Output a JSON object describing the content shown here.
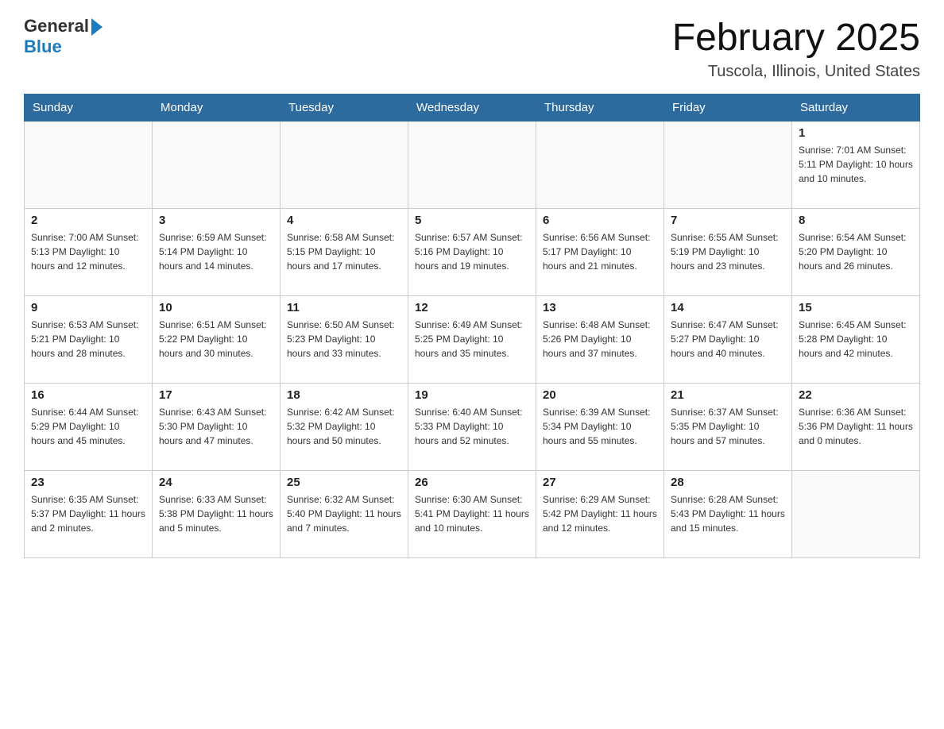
{
  "logo": {
    "text_general": "General",
    "text_blue": "Blue"
  },
  "header": {
    "month_year": "February 2025",
    "location": "Tuscola, Illinois, United States"
  },
  "days_of_week": [
    "Sunday",
    "Monday",
    "Tuesday",
    "Wednesday",
    "Thursday",
    "Friday",
    "Saturday"
  ],
  "weeks": [
    [
      {
        "day": "",
        "info": ""
      },
      {
        "day": "",
        "info": ""
      },
      {
        "day": "",
        "info": ""
      },
      {
        "day": "",
        "info": ""
      },
      {
        "day": "",
        "info": ""
      },
      {
        "day": "",
        "info": ""
      },
      {
        "day": "1",
        "info": "Sunrise: 7:01 AM\nSunset: 5:11 PM\nDaylight: 10 hours and 10 minutes."
      }
    ],
    [
      {
        "day": "2",
        "info": "Sunrise: 7:00 AM\nSunset: 5:13 PM\nDaylight: 10 hours and 12 minutes."
      },
      {
        "day": "3",
        "info": "Sunrise: 6:59 AM\nSunset: 5:14 PM\nDaylight: 10 hours and 14 minutes."
      },
      {
        "day": "4",
        "info": "Sunrise: 6:58 AM\nSunset: 5:15 PM\nDaylight: 10 hours and 17 minutes."
      },
      {
        "day": "5",
        "info": "Sunrise: 6:57 AM\nSunset: 5:16 PM\nDaylight: 10 hours and 19 minutes."
      },
      {
        "day": "6",
        "info": "Sunrise: 6:56 AM\nSunset: 5:17 PM\nDaylight: 10 hours and 21 minutes."
      },
      {
        "day": "7",
        "info": "Sunrise: 6:55 AM\nSunset: 5:19 PM\nDaylight: 10 hours and 23 minutes."
      },
      {
        "day": "8",
        "info": "Sunrise: 6:54 AM\nSunset: 5:20 PM\nDaylight: 10 hours and 26 minutes."
      }
    ],
    [
      {
        "day": "9",
        "info": "Sunrise: 6:53 AM\nSunset: 5:21 PM\nDaylight: 10 hours and 28 minutes."
      },
      {
        "day": "10",
        "info": "Sunrise: 6:51 AM\nSunset: 5:22 PM\nDaylight: 10 hours and 30 minutes."
      },
      {
        "day": "11",
        "info": "Sunrise: 6:50 AM\nSunset: 5:23 PM\nDaylight: 10 hours and 33 minutes."
      },
      {
        "day": "12",
        "info": "Sunrise: 6:49 AM\nSunset: 5:25 PM\nDaylight: 10 hours and 35 minutes."
      },
      {
        "day": "13",
        "info": "Sunrise: 6:48 AM\nSunset: 5:26 PM\nDaylight: 10 hours and 37 minutes."
      },
      {
        "day": "14",
        "info": "Sunrise: 6:47 AM\nSunset: 5:27 PM\nDaylight: 10 hours and 40 minutes."
      },
      {
        "day": "15",
        "info": "Sunrise: 6:45 AM\nSunset: 5:28 PM\nDaylight: 10 hours and 42 minutes."
      }
    ],
    [
      {
        "day": "16",
        "info": "Sunrise: 6:44 AM\nSunset: 5:29 PM\nDaylight: 10 hours and 45 minutes."
      },
      {
        "day": "17",
        "info": "Sunrise: 6:43 AM\nSunset: 5:30 PM\nDaylight: 10 hours and 47 minutes."
      },
      {
        "day": "18",
        "info": "Sunrise: 6:42 AM\nSunset: 5:32 PM\nDaylight: 10 hours and 50 minutes."
      },
      {
        "day": "19",
        "info": "Sunrise: 6:40 AM\nSunset: 5:33 PM\nDaylight: 10 hours and 52 minutes."
      },
      {
        "day": "20",
        "info": "Sunrise: 6:39 AM\nSunset: 5:34 PM\nDaylight: 10 hours and 55 minutes."
      },
      {
        "day": "21",
        "info": "Sunrise: 6:37 AM\nSunset: 5:35 PM\nDaylight: 10 hours and 57 minutes."
      },
      {
        "day": "22",
        "info": "Sunrise: 6:36 AM\nSunset: 5:36 PM\nDaylight: 11 hours and 0 minutes."
      }
    ],
    [
      {
        "day": "23",
        "info": "Sunrise: 6:35 AM\nSunset: 5:37 PM\nDaylight: 11 hours and 2 minutes."
      },
      {
        "day": "24",
        "info": "Sunrise: 6:33 AM\nSunset: 5:38 PM\nDaylight: 11 hours and 5 minutes."
      },
      {
        "day": "25",
        "info": "Sunrise: 6:32 AM\nSunset: 5:40 PM\nDaylight: 11 hours and 7 minutes."
      },
      {
        "day": "26",
        "info": "Sunrise: 6:30 AM\nSunset: 5:41 PM\nDaylight: 11 hours and 10 minutes."
      },
      {
        "day": "27",
        "info": "Sunrise: 6:29 AM\nSunset: 5:42 PM\nDaylight: 11 hours and 12 minutes."
      },
      {
        "day": "28",
        "info": "Sunrise: 6:28 AM\nSunset: 5:43 PM\nDaylight: 11 hours and 15 minutes."
      },
      {
        "day": "",
        "info": ""
      }
    ]
  ]
}
